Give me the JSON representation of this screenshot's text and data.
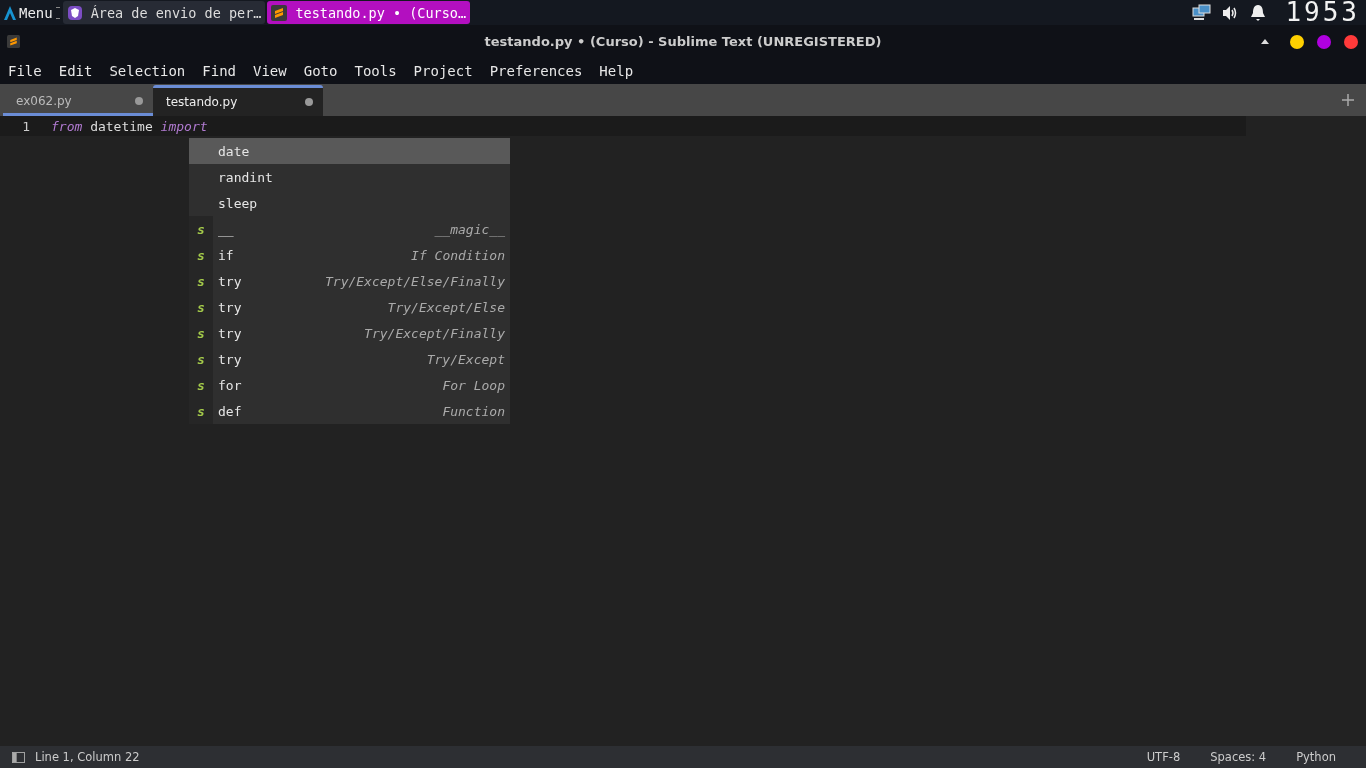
{
  "panel": {
    "menu_label": "Menu",
    "tasks": [
      {
        "title": "Área de envio de per…",
        "selected": false,
        "kind": "browser"
      },
      {
        "title": "testando.py • (Curso…",
        "selected": true,
        "kind": "editor"
      }
    ],
    "clock": "1953"
  },
  "window": {
    "title": "testando.py • (Curso) - Sublime Text (UNREGISTERED)"
  },
  "menu": [
    "File",
    "Edit",
    "Selection",
    "Find",
    "View",
    "Goto",
    "Tools",
    "Project",
    "Preferences",
    "Help"
  ],
  "tabs": [
    {
      "label": "ex062.py",
      "selected": false,
      "modified": true
    },
    {
      "label": "testando.py",
      "selected": true,
      "modified": true
    }
  ],
  "editor": {
    "lines": [
      {
        "number": "1",
        "tokens": [
          {
            "text": "from",
            "kind": "keyword"
          },
          {
            "text": " datetime ",
            "kind": "plain"
          },
          {
            "text": "import",
            "kind": "keyword"
          }
        ]
      }
    ]
  },
  "completions": [
    {
      "kind": "word",
      "label": "date",
      "selected": true
    },
    {
      "kind": "word",
      "label": "randint",
      "selected": false
    },
    {
      "kind": "word",
      "label": "sleep",
      "selected": false
    },
    {
      "kind": "snippet",
      "badge": "s",
      "label": "__",
      "hint": "__magic__",
      "selected": false
    },
    {
      "kind": "snippet",
      "badge": "s",
      "label": "if",
      "hint": "If Condition",
      "selected": false
    },
    {
      "kind": "snippet",
      "badge": "s",
      "label": "try",
      "hint": "Try/Except/Else/Finally",
      "selected": false
    },
    {
      "kind": "snippet",
      "badge": "s",
      "label": "try",
      "hint": "Try/Except/Else",
      "selected": false
    },
    {
      "kind": "snippet",
      "badge": "s",
      "label": "try",
      "hint": "Try/Except/Finally",
      "selected": false
    },
    {
      "kind": "snippet",
      "badge": "s",
      "label": "try",
      "hint": "Try/Except",
      "selected": false
    },
    {
      "kind": "snippet",
      "badge": "s",
      "label": "for",
      "hint": "For Loop",
      "selected": false
    },
    {
      "kind": "snippet",
      "badge": "s",
      "label": "def",
      "hint": "Function",
      "selected": false
    }
  ],
  "status_bar": {
    "position": "Line 1, Column 22",
    "encoding": "UTF-8",
    "indent": "Spaces: 4",
    "syntax": "Python"
  }
}
